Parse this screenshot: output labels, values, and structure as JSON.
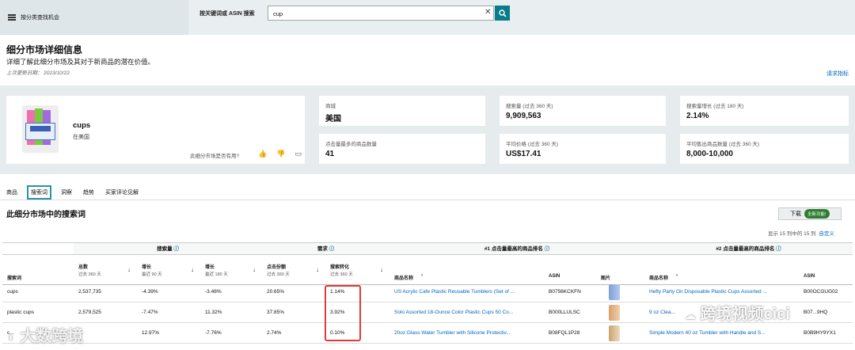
{
  "topbar": {
    "menu_label": "按分类查找机会",
    "search_label": "按关键词或 ASIN 搜索",
    "search_value": "cup",
    "clear_glyph": "✕"
  },
  "header": {
    "title": "细分市场详细信息",
    "subtitle": "详细了解此细分市场及其对于新商品的潜在价值。",
    "updated": "上次更新日期： 2023/10/22",
    "request_link": "请求指标"
  },
  "product": {
    "name": "cups",
    "location": "在美国",
    "useful_q": "此细分市场是否有用?"
  },
  "stats": [
    {
      "label": "商城",
      "value": "美国"
    },
    {
      "label": "搜索量 (过去 360 天)",
      "value": "9,909,563"
    },
    {
      "label": "搜索量增长 (过去 180 天)",
      "value": "2.14%"
    },
    {
      "label": "点击量最多的商品数量",
      "value": "41"
    },
    {
      "label": "平均价格 (过去 360 天)",
      "value": "US$17.41"
    },
    {
      "label": "平均售出商品数量 (过去 360 天)",
      "value": "8,000-10,000"
    }
  ],
  "tabs": [
    "商品",
    "搜索词",
    "洞察",
    "趋势",
    "买家评论见解"
  ],
  "active_tab": 1,
  "section": {
    "title": "此细分市场中的搜索词",
    "download": "下载",
    "new_badge": "全新功能!",
    "showing": "显示 15 列中的 15 列",
    "customize": "自定义"
  },
  "table": {
    "groups": {
      "volume": "搜索量",
      "demand": "需求",
      "top1": "#1 点击量最高的商品排名",
      "top2": "#2 点击量最高的商品排名"
    },
    "headers": {
      "term": "搜索词",
      "total": "总数",
      "total_sub": "过去 360 天",
      "g90": "增长",
      "g90_sub": "最近 90 天",
      "g180": "增长",
      "g180_sub": "最近 180 天",
      "click": "点击份额",
      "click_sub": "过去 360 天",
      "conv": "搜索转化",
      "conv_sub": "过去 360 天",
      "pname": "商品名称",
      "asin": "ASIN",
      "img": "图片",
      "pname2": "商品名称",
      "asin2": "ASIN"
    },
    "rows": [
      {
        "term": "cups",
        "total": "2,537,735",
        "g90": "-4.39%",
        "g180": "-3.48%",
        "click": "20.65%",
        "conv": "1.14%",
        "p1": "US Acrylic Cafe Plastic Reusable Tumblers (Set of ...",
        "a1": "B0756KCKFN",
        "p2": "Hefty Party On Disposable Plastic Cups Assorted ...",
        "a2": "B00OCGUG02"
      },
      {
        "term": "plastic cups",
        "total": "2,579,525",
        "g90": "-7.47%",
        "g180": "11.32%",
        "click": "37.85%",
        "conv": "3.92%",
        "p1": "Solo Assorted 18-Ounce Color Plastic Cups 50 Co...",
        "a1": "B000LLULSC",
        "p2": "9 oz Clea...",
        "a2": "B07...9HQ"
      },
      {
        "term": "c...",
        "total": "...",
        "g90": "12.97%",
        "g180": "-7.76%",
        "click": "2.74%",
        "conv": "0.10%",
        "p1": "20oz Glass Water Tumbler with Silicone Protectiv...",
        "a1": "B08FQL1P28",
        "p2": "Simple Modern 40 oz Tumbler with Handle and S...",
        "a2": "B0B9HY9YX1"
      }
    ]
  },
  "watermarks": {
    "left": "大数跨境",
    "right": "跨境视频cici"
  },
  "colors": {
    "accent": "#0a7b8a",
    "link": "#0066c0",
    "highlight": "#e03b3b",
    "badge": "#2e7d32"
  }
}
